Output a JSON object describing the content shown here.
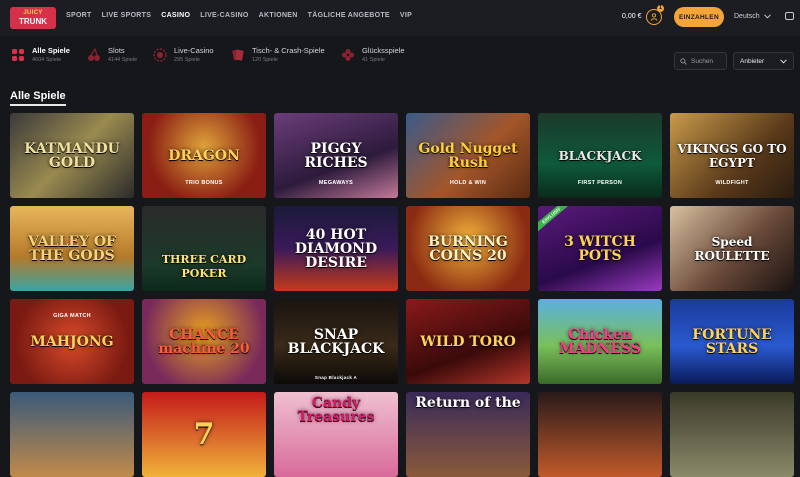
{
  "brand": {
    "line1": "JUICY",
    "line2": "TRUNK"
  },
  "nav": [
    "SPORT",
    "LIVE SPORTS",
    "CASINO",
    "LIVE-CASINO",
    "AKTIONEN",
    "TÄGLICHE ANGEBOTE",
    "VIP"
  ],
  "nav_active": "CASINO",
  "header": {
    "balance": "0,00 €",
    "notifications": "1",
    "deposit_label": "EINZAHLEN",
    "language": "Deutsch"
  },
  "categories": [
    {
      "label": "Alle Spiele",
      "count": "4604 Spiele"
    },
    {
      "label": "Slots",
      "count": "4144 Spiele"
    },
    {
      "label": "Live-Casino",
      "count": "295 Spiele"
    },
    {
      "label": "Tisch- & Crash-Spiele",
      "count": "120 Spiele"
    },
    {
      "label": "Glücksspiele",
      "count": "41 Spiele"
    }
  ],
  "search": {
    "placeholder": "Suchen"
  },
  "provider": {
    "label": "Anbieter"
  },
  "section": {
    "title": "Alle Spiele"
  },
  "games": [
    {
      "name": "KATMANDU GOLD",
      "sub": "",
      "badge": ""
    },
    {
      "name": "DRAGON",
      "sub": "TRIO BONUS",
      "badge": ""
    },
    {
      "name": "PIGGY RICHES",
      "sub": "MEGAWAYS",
      "badge": ""
    },
    {
      "name": "Gold Nugget Rush",
      "sub": "HOLD & WIN",
      "badge": ""
    },
    {
      "name": "BLACKJACK",
      "sub": "FIRST PERSON",
      "badge": ""
    },
    {
      "name": "VIKINGS GO TO EGYPT",
      "sub": "WILDFIGHT",
      "badge": ""
    },
    {
      "name": "VALLEY OF THE GODS",
      "sub": "",
      "badge": ""
    },
    {
      "name": "THREE CARD POKER",
      "sub": "",
      "badge": ""
    },
    {
      "name": "40 HOT DIAMOND DESIRE",
      "sub": "",
      "badge": ""
    },
    {
      "name": "BURNING COINS 20",
      "sub": "",
      "badge": ""
    },
    {
      "name": "3 WITCH POTS",
      "sub": "",
      "badge": "EXKLUSIV"
    },
    {
      "name": "Speed ROULETTE",
      "sub": "",
      "badge": ""
    },
    {
      "name": "MAHJONG",
      "sub": "GIGA MATCH",
      "badge": ""
    },
    {
      "name": "CHANCE machine 20",
      "sub": "",
      "badge": ""
    },
    {
      "name": "SNAP BLACKJACK",
      "sub": "Snap Blackjack A",
      "badge": ""
    },
    {
      "name": "WILD TORO",
      "sub": "",
      "badge": ""
    },
    {
      "name": "Chicken MADNESS",
      "sub": "",
      "badge": ""
    },
    {
      "name": "FORTUNE STARS",
      "sub": "",
      "badge": ""
    },
    {
      "name": "",
      "sub": "",
      "badge": ""
    },
    {
      "name": "7",
      "sub": "",
      "badge": ""
    },
    {
      "name": "Candy Treasures",
      "sub": "",
      "badge": ""
    },
    {
      "name": "Return of the",
      "sub": "",
      "badge": ""
    },
    {
      "name": "",
      "sub": "",
      "badge": ""
    },
    {
      "name": "",
      "sub": "",
      "badge": ""
    }
  ],
  "colors": {
    "accent": "#f4a53a",
    "background": "#16171b",
    "topbar": "#1c1d22"
  }
}
